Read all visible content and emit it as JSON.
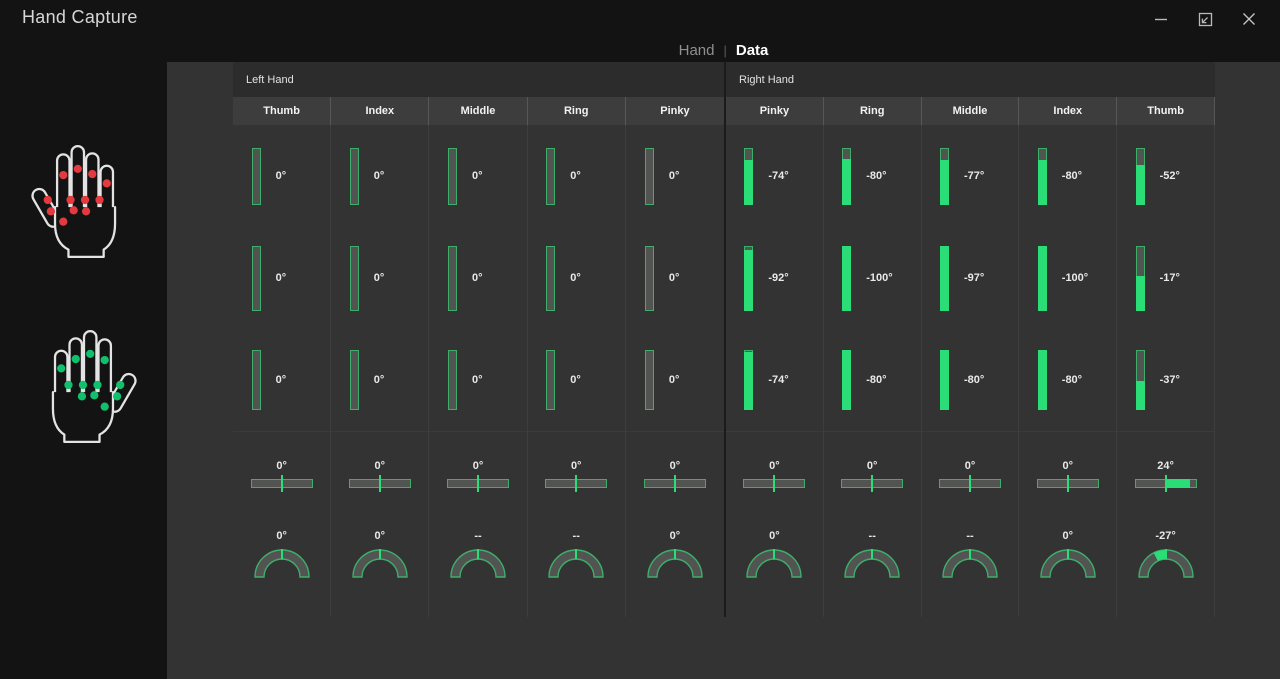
{
  "window": {
    "title": "Hand Capture"
  },
  "tabs": [
    {
      "label": "Hand",
      "active": false
    },
    {
      "label": "Data",
      "active": true
    }
  ],
  "colors": {
    "accent": "#2bdd77",
    "gauge_border": "#3fae6b",
    "gauge_track": "#515451",
    "dot_red": "#e23a3e",
    "dot_green": "#10c06c",
    "hand_outline": "#e3e3e3",
    "page_bg": "#131313",
    "content_bg": "#333333"
  },
  "hands": [
    {
      "id": "left-hand-red",
      "mirrored": false,
      "dot_color": "#e23a3e",
      "dots": [
        [
          25,
          33
        ],
        [
          39,
          27
        ],
        [
          53,
          32
        ],
        [
          67,
          41
        ],
        [
          32,
          57
        ],
        [
          46,
          57
        ],
        [
          60,
          57
        ],
        [
          35,
          67
        ],
        [
          47,
          68
        ],
        [
          10,
          57
        ],
        [
          13,
          68
        ],
        [
          25,
          78
        ]
      ]
    },
    {
      "id": "right-hand-green",
      "mirrored": true,
      "dot_color": "#10c06c",
      "dots": [
        [
          65,
          33
        ],
        [
          51,
          27
        ],
        [
          37,
          32
        ],
        [
          23,
          41
        ],
        [
          58,
          57
        ],
        [
          44,
          57
        ],
        [
          30,
          57
        ],
        [
          55,
          67
        ],
        [
          43,
          68
        ],
        [
          80,
          57
        ],
        [
          77,
          68
        ],
        [
          65,
          78
        ]
      ]
    }
  ],
  "panel": {
    "left": {
      "label": "Left Hand",
      "fingers": [
        {
          "name": "Thumb",
          "joints": [
            {
              "value": "0°",
              "fill": 0
            },
            {
              "value": "0°",
              "fill": 0
            },
            {
              "value": "0°",
              "fill": 0
            }
          ],
          "spread": {
            "value": "0°",
            "fill": 0
          },
          "curl": {
            "value": "0°",
            "fill": 0
          }
        },
        {
          "name": "Index",
          "joints": [
            {
              "value": "0°",
              "fill": 0
            },
            {
              "value": "0°",
              "fill": 0
            },
            {
              "value": "0°",
              "fill": 0
            }
          ],
          "spread": {
            "value": "0°",
            "fill": 0
          },
          "curl": {
            "value": "0°",
            "fill": 0
          }
        },
        {
          "name": "Middle",
          "joints": [
            {
              "value": "0°",
              "fill": 0
            },
            {
              "value": "0°",
              "fill": 0
            },
            {
              "value": "0°",
              "fill": 0
            }
          ],
          "spread": {
            "value": "0°",
            "fill": 0
          },
          "curl": {
            "value": "--",
            "fill": 0
          }
        },
        {
          "name": "Ring",
          "joints": [
            {
              "value": "0°",
              "fill": 0
            },
            {
              "value": "0°",
              "fill": 0
            },
            {
              "value": "0°",
              "fill": 0
            }
          ],
          "spread": {
            "value": "0°",
            "fill": 0
          },
          "curl": {
            "value": "--",
            "fill": 0
          }
        },
        {
          "name": "Pinky",
          "joints": [
            {
              "value": "0°",
              "fill": 0
            },
            {
              "value": "0°",
              "fill": 0
            },
            {
              "value": "0°",
              "fill": 0
            }
          ],
          "spread": {
            "value": "0°",
            "fill": 0
          },
          "curl": {
            "value": "0°",
            "fill": 0
          }
        }
      ]
    },
    "right": {
      "label": "Right Hand",
      "fingers": [
        {
          "name": "Pinky",
          "joints": [
            {
              "value": "-74°",
              "fill": 0.78
            },
            {
              "value": "-92°",
              "fill": 0.93
            },
            {
              "value": "-74°",
              "fill": 0.96
            }
          ],
          "spread": {
            "value": "0°",
            "fill": 0
          },
          "curl": {
            "value": "0°",
            "fill": 0
          }
        },
        {
          "name": "Ring",
          "joints": [
            {
              "value": "-80°",
              "fill": 0.8
            },
            {
              "value": "-100°",
              "fill": 1
            },
            {
              "value": "-80°",
              "fill": 1
            }
          ],
          "spread": {
            "value": "0°",
            "fill": 0
          },
          "curl": {
            "value": "--",
            "fill": 0
          }
        },
        {
          "name": "Middle",
          "joints": [
            {
              "value": "-77°",
              "fill": 0.78
            },
            {
              "value": "-97°",
              "fill": 1
            },
            {
              "value": "-80°",
              "fill": 1
            }
          ],
          "spread": {
            "value": "0°",
            "fill": 0
          },
          "curl": {
            "value": "--",
            "fill": 0
          }
        },
        {
          "name": "Index",
          "joints": [
            {
              "value": "-80°",
              "fill": 0.78
            },
            {
              "value": "-100°",
              "fill": 1
            },
            {
              "value": "-80°",
              "fill": 1
            }
          ],
          "spread": {
            "value": "0°",
            "fill": 0
          },
          "curl": {
            "value": "0°",
            "fill": 0
          }
        },
        {
          "name": "Thumb",
          "joints": [
            {
              "value": "-52°",
              "fill": 0.68
            },
            {
              "value": "-17°",
              "fill": 0.52
            },
            {
              "value": "-37°",
              "fill": 0.47
            }
          ],
          "spread": {
            "value": "24°",
            "fill": 0.8
          },
          "curl": {
            "value": "-27°",
            "fill": -0.3
          }
        }
      ]
    }
  }
}
